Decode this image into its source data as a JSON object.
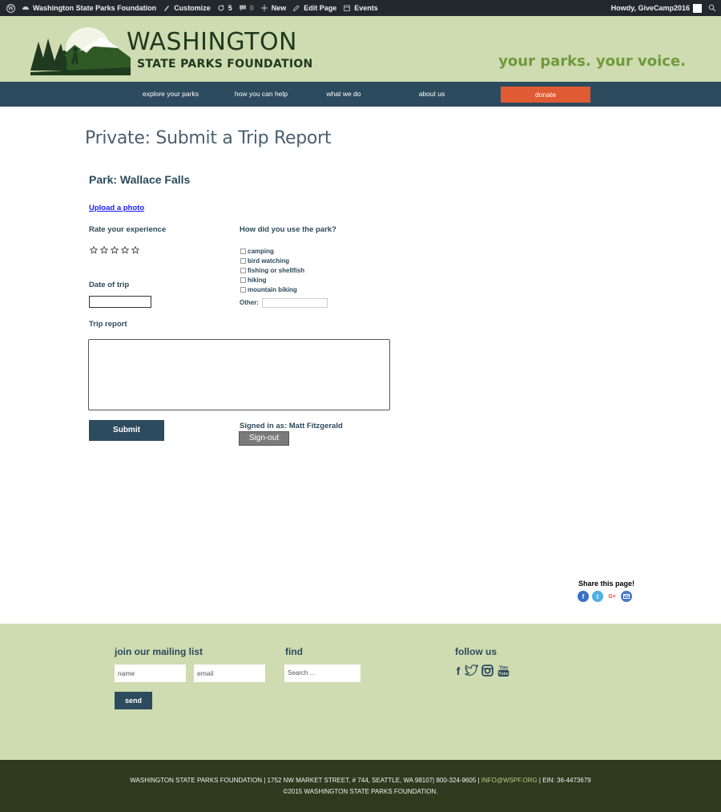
{
  "adminbar": {
    "site_name": "Washington State Parks Foundation",
    "customize": "Customize",
    "updates_count": "5",
    "comments_count": "0",
    "new_label": "New",
    "edit_page": "Edit Page",
    "events": "Events",
    "howdy": "Howdy, GiveCamp2016"
  },
  "header": {
    "logo_line1": "WASHINGTON",
    "logo_line2": "STATE PARKS FOUNDATION",
    "tagline": "your parks. your voice."
  },
  "nav": {
    "items": [
      "explore your parks",
      "how you can help",
      "what we do",
      "about us"
    ],
    "donate": "donate"
  },
  "main": {
    "page_title": "Private: Submit a Trip Report",
    "park_name": "Park: Wallace Falls",
    "upload_photo": "Upload a photo",
    "rate_label": "Rate your experience",
    "rating": 0,
    "rating_max": 5,
    "usage_label": "How did you use the park?",
    "usage_options": [
      "camping",
      "bird watching",
      "fishing or shellfish",
      "hiking",
      "mountain biking"
    ],
    "other_label": "Other:",
    "date_label": "Date of trip",
    "trip_report_label": "Trip report",
    "submit": "Submit",
    "signed_in": "Signed in as: Matt Fitzgerald",
    "sign_out": "Sign-out"
  },
  "share": {
    "label": "Share this page!",
    "icons": [
      "facebook-icon",
      "twitter-icon",
      "google-plus-icon",
      "email-icon"
    ],
    "colors": [
      "#3b6fc6",
      "#4fb0e8",
      "#e0533f",
      "#4a78c8"
    ]
  },
  "footer": {
    "mailing_heading": "join our mailing list",
    "name_placeholder": "name",
    "email_placeholder": "email",
    "send": "send",
    "find_heading": "find",
    "search_placeholder": "Search ...",
    "follow_heading": "follow us",
    "social_icons": [
      "facebook-icon",
      "twitter-icon",
      "instagram-icon",
      "youtube-icon"
    ]
  },
  "bottombar": {
    "line1_prefix": "WASHINGTON STATE PARKS FOUNDATION | 1752 NW MARKET STREET, # 744, SEATTLE, WA 98107| 800-324-9605 | ",
    "email": "INFO@WSPF.ORG",
    "line1_suffix": " | EIN: 36-4473679",
    "line2": "©2015 WASHINGTON STATE PARKS FOUNDATION."
  },
  "colors": {
    "header_bg": "#cfdbb0",
    "nav_bg": "#2d4b5e",
    "donate_bg": "#e05a33",
    "tagline": "#6f9a3c",
    "bottom_bg": "#2e3a1e"
  }
}
